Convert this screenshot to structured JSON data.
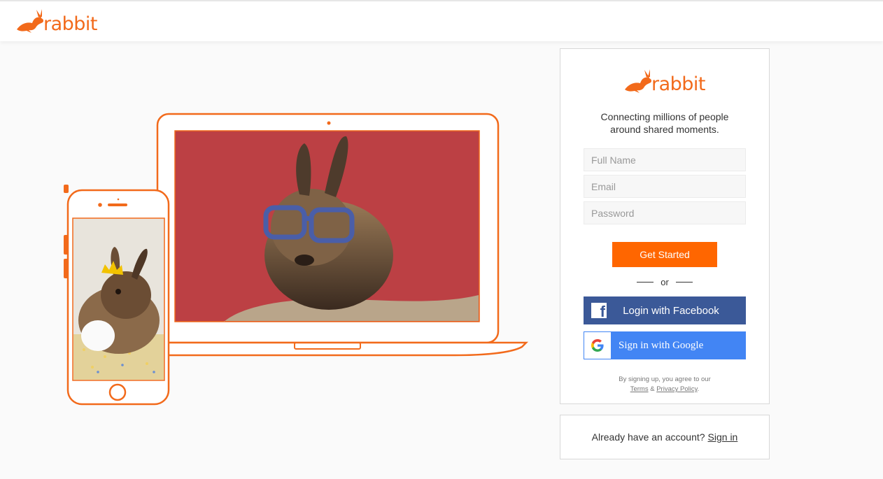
{
  "header": {
    "brand": "rabbit"
  },
  "card": {
    "brand": "rabbit",
    "tagline_line1": "Connecting millions of people",
    "tagline_line2": "around shared moments.",
    "fields": {
      "full_name_placeholder": "Full Name",
      "email_placeholder": "Email",
      "password_placeholder": "Password"
    },
    "get_started_label": "Get Started",
    "or_label": "or",
    "facebook_label": "Login with Facebook",
    "google_label": "Sign in with Google",
    "legal_prefix": "By signing up, you agree to our",
    "terms_label": "Terms",
    "legal_and": "&",
    "privacy_label": "Privacy Policy",
    "legal_suffix": "."
  },
  "signin": {
    "prompt": "Already have an account?",
    "link_label": "Sign in"
  },
  "colors": {
    "brand_orange": "#ff6600",
    "facebook_blue": "#3b5998",
    "google_blue": "#4285f4"
  },
  "icons": [
    "rabbit-logo-icon",
    "facebook-icon",
    "google-icon"
  ]
}
